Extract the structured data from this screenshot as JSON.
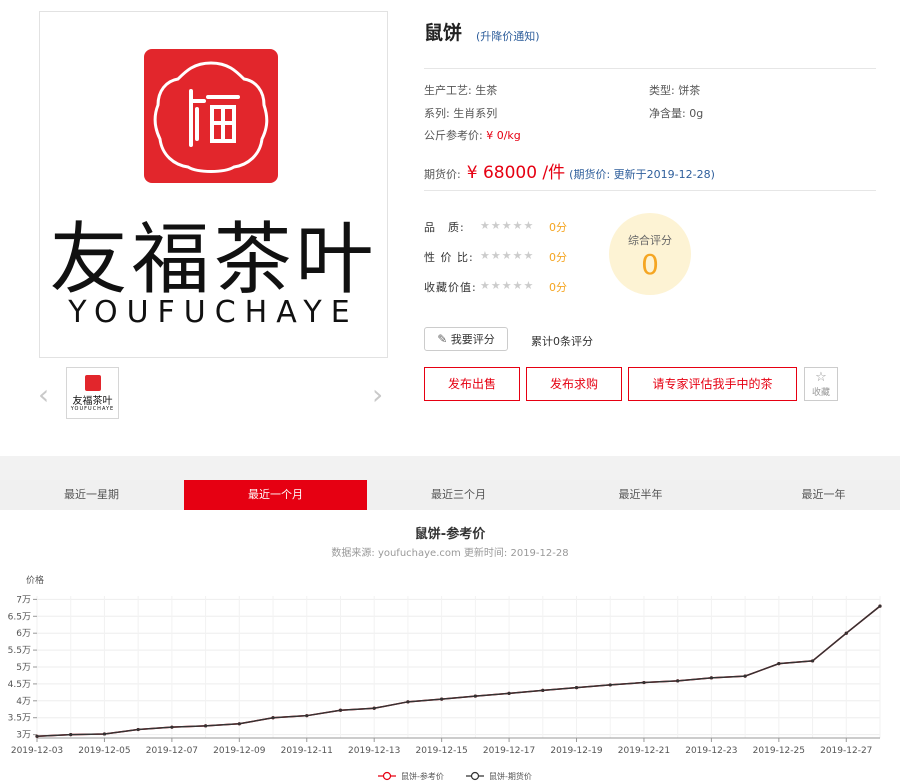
{
  "product": {
    "logo_text": "友福茶叶",
    "logo_sub": "YOUFUCHAYE",
    "title": "鼠饼",
    "notice": "(升降价通知)",
    "props": [
      {
        "label": "生产工艺:",
        "value": "生茶"
      },
      {
        "label": "类型:",
        "value": "饼茶"
      },
      {
        "label": "系列:",
        "value": "生肖系列"
      },
      {
        "label": "净含量:",
        "value": "0g"
      },
      {
        "label": "公斤参考价:",
        "value": "¥ 0/kg"
      }
    ],
    "price_label": "期货价:",
    "price_value": "¥ 68000 /件",
    "price_update": "(期货价: 更新于2019-12-28)"
  },
  "ratings": {
    "rows": [
      {
        "label": "品　质:",
        "stars": "★★★★★",
        "score": "0分"
      },
      {
        "label": "性 价 比:",
        "stars": "★★★★★",
        "score": "0分"
      },
      {
        "label": "收藏价值:",
        "stars": "★★★★★",
        "score": "0分"
      }
    ],
    "overall_label": "综合评分",
    "overall_value": "0",
    "review_button": "我要评分",
    "review_count": "累计0条评分"
  },
  "actions": {
    "sell": "发布出售",
    "buy": "发布求购",
    "expert": "请专家评估我手中的茶",
    "fav": "收藏"
  },
  "tabs": [
    "最近一星期",
    "最近一个月",
    "最近三个月",
    "最近半年",
    "最近一年"
  ],
  "active_tab": 1,
  "chart": {
    "title": "鼠饼-参考价",
    "subtitle": "数据来源: youfuchaye.com 更新时间: 2019-12-28"
  },
  "chart_data": {
    "type": "line",
    "ylabel": "价格",
    "ylim": [
      29000,
      71000
    ],
    "yticks": [
      30000,
      35000,
      40000,
      45000,
      50000,
      55000,
      60000,
      65000,
      70000
    ],
    "ytick_labels": [
      "3万",
      "3.5万",
      "4万",
      "4.5万",
      "5万",
      "5.5万",
      "6万",
      "6.5万",
      "7万"
    ],
    "x": [
      "2019-12-03",
      "2019-12-04",
      "2019-12-05",
      "2019-12-06",
      "2019-12-07",
      "2019-12-08",
      "2019-12-09",
      "2019-12-10",
      "2019-12-11",
      "2019-12-12",
      "2019-12-13",
      "2019-12-14",
      "2019-12-15",
      "2019-12-16",
      "2019-12-17",
      "2019-12-18",
      "2019-12-19",
      "2019-12-20",
      "2019-12-21",
      "2019-12-22",
      "2019-12-23",
      "2019-12-24",
      "2019-12-25",
      "2019-12-26",
      "2019-12-27",
      "2019-12-28"
    ],
    "xtick_labels": [
      "2019-12-03",
      "2019-12-05",
      "2019-12-07",
      "2019-12-09",
      "2019-12-11",
      "2019-12-13",
      "2019-12-15",
      "2019-12-17",
      "2019-12-19",
      "2019-12-21",
      "2019-12-23",
      "2019-12-25",
      "2019-12-27"
    ],
    "series": [
      {
        "name": "鼠饼-参考价",
        "color": "#e60012",
        "values": [
          29500,
          30000,
          30200,
          31500,
          32200,
          32600,
          33200,
          35000,
          35600,
          37200,
          37800,
          39700,
          40500,
          41400,
          42200,
          43100,
          43900,
          44700,
          45400,
          45900,
          46800,
          47300,
          51000,
          51800,
          60000,
          68000
        ]
      },
      {
        "name": "鼠饼-期货价",
        "color": "#333333",
        "values": [
          29500,
          30000,
          30200,
          31500,
          32200,
          32600,
          33200,
          35000,
          35600,
          37200,
          37800,
          39700,
          40500,
          41400,
          42200,
          43100,
          43900,
          44700,
          45400,
          45900,
          46800,
          47300,
          51000,
          51800,
          60000,
          68000
        ]
      }
    ]
  }
}
